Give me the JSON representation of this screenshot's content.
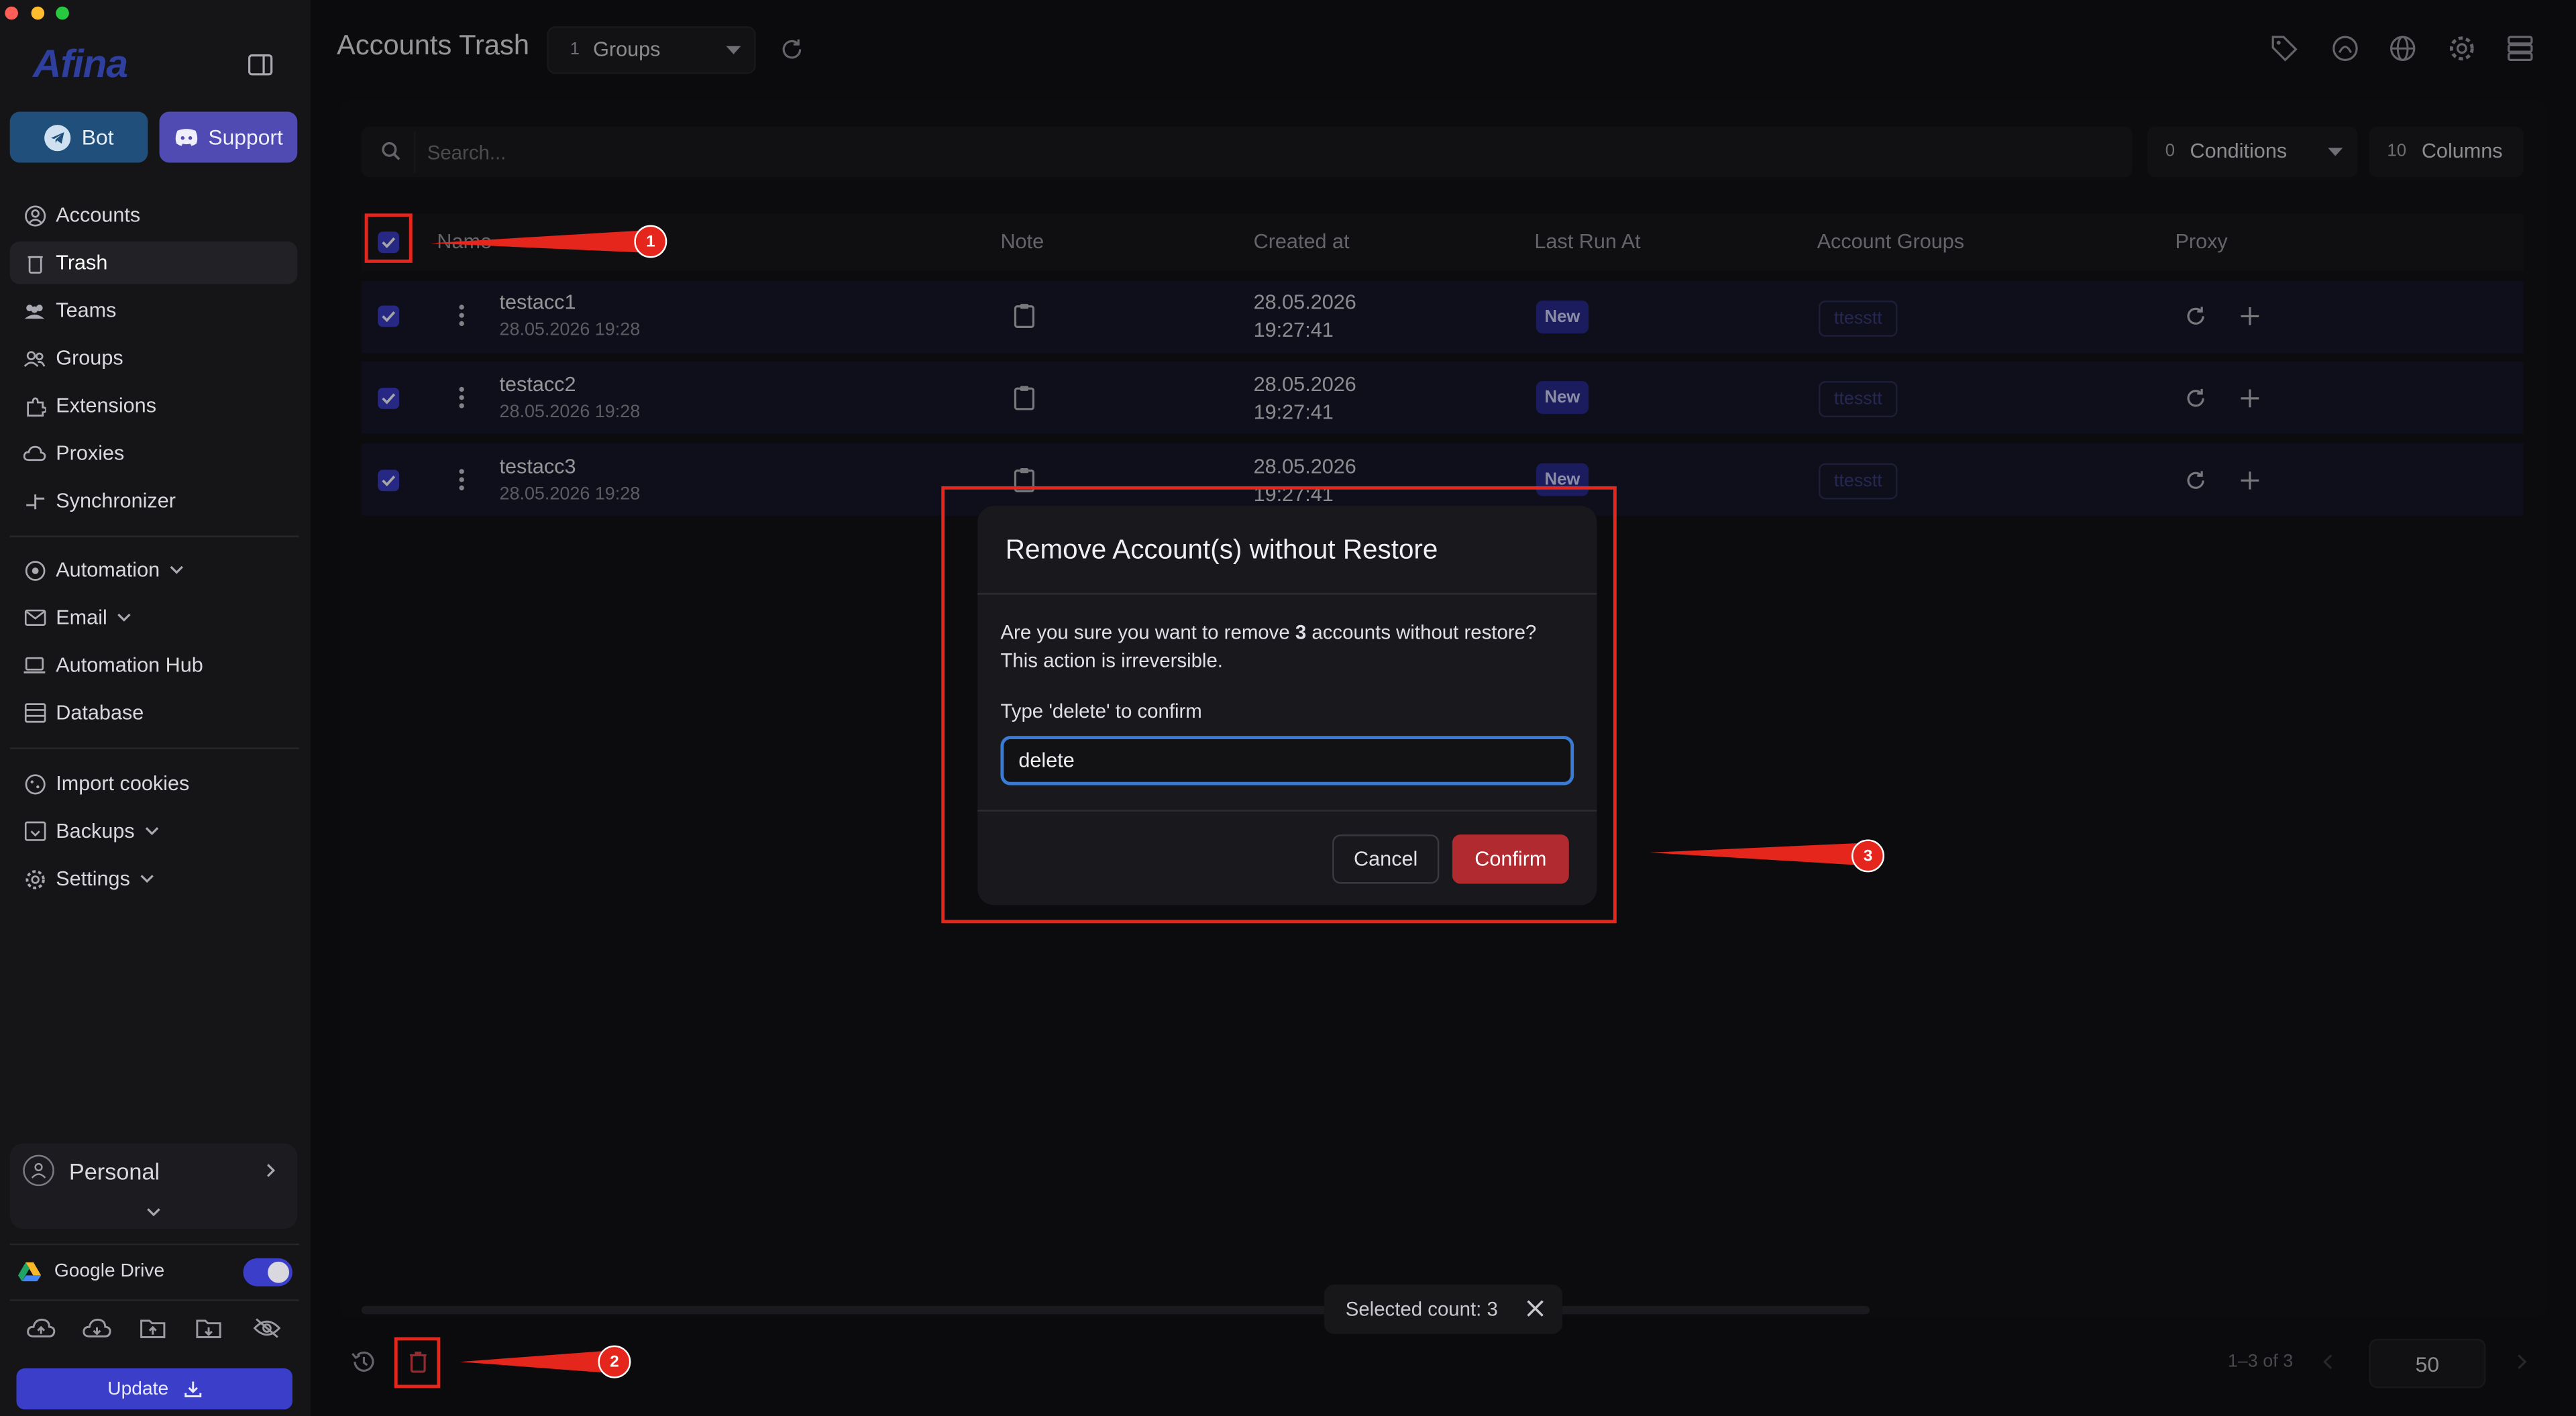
{
  "app": {
    "logo": "Afina",
    "title": "Accounts Trash"
  },
  "top_buttons": {
    "bot": "Bot",
    "support": "Support"
  },
  "nav": {
    "items": [
      {
        "label": "Accounts"
      },
      {
        "label": "Trash"
      },
      {
        "label": "Teams"
      },
      {
        "label": "Groups"
      },
      {
        "label": "Extensions"
      },
      {
        "label": "Proxies"
      },
      {
        "label": "Synchronizer"
      },
      {
        "label": "Automation"
      },
      {
        "label": "Email"
      },
      {
        "label": "Automation Hub"
      },
      {
        "label": "Database"
      },
      {
        "label": "Import cookies"
      },
      {
        "label": "Backups"
      },
      {
        "label": "Settings"
      }
    ]
  },
  "profile": {
    "name": "Personal"
  },
  "drive": {
    "label": "Google Drive",
    "enabled": true
  },
  "update_button": "Update",
  "header": {
    "groups_count": "1",
    "groups_label": "Groups"
  },
  "search": {
    "placeholder": "Search...",
    "conditions_count": "0",
    "conditions_label": "Conditions",
    "columns_count": "10",
    "columns_label": "Columns"
  },
  "table": {
    "columns": [
      "Name",
      "Note",
      "Created at",
      "Last Run At",
      "Account Groups",
      "Proxy"
    ],
    "rows": [
      {
        "name": "testacc1",
        "sub": "28.05.2026 19:28",
        "created_date": "28.05.2026",
        "created_time": "19:27:41",
        "last_run": "New",
        "group": "ttesstt"
      },
      {
        "name": "testacc2",
        "sub": "28.05.2026 19:28",
        "created_date": "28.05.2026",
        "created_time": "19:27:41",
        "last_run": "New",
        "group": "ttesstt"
      },
      {
        "name": "testacc3",
        "sub": "28.05.2026 19:28",
        "created_date": "28.05.2026",
        "created_time": "19:27:41",
        "last_run": "New",
        "group": "ttesstt"
      }
    ]
  },
  "modal": {
    "title": "Remove Account(s) without Restore",
    "text_before": "Are you sure you want to remove ",
    "count": "3",
    "text_after": " accounts without restore?",
    "text_line2": "This action is irreversible.",
    "input_label": "Type 'delete' to confirm",
    "input_value": "delete",
    "cancel": "Cancel",
    "confirm": "Confirm"
  },
  "selection": {
    "label": "Selected count: 3"
  },
  "pagination": {
    "range": "1–3 of 3",
    "page_size": "50"
  },
  "annotations": {
    "n1": "1",
    "n2": "2",
    "n3": "3"
  },
  "colors": {
    "accent": "#3b3ec9",
    "danger": "#b02a30",
    "annotation": "#e5261c"
  }
}
